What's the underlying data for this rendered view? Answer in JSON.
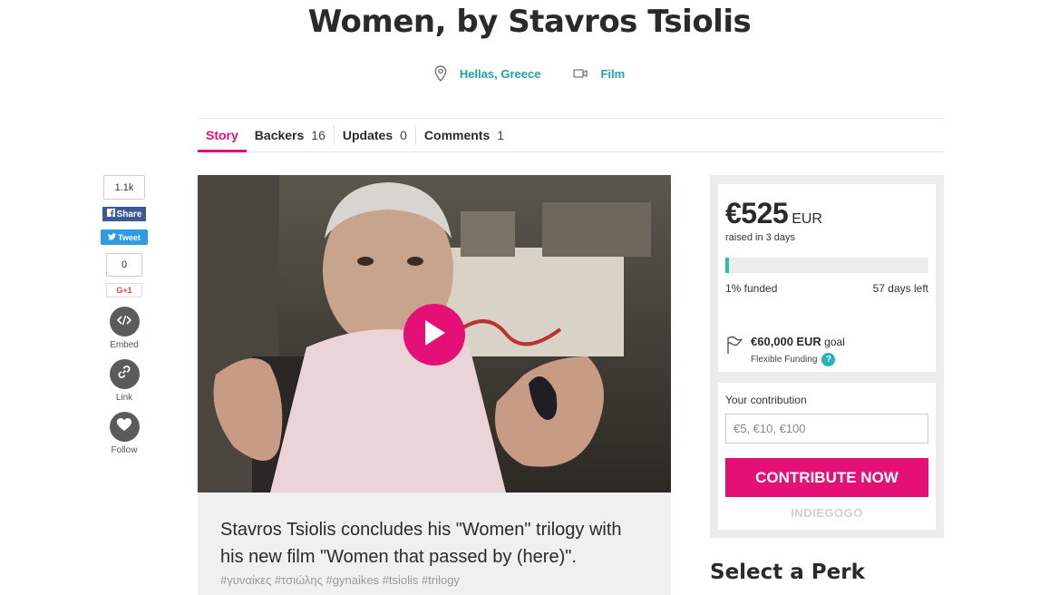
{
  "campaign": {
    "title": "Women, by Stavros Tsiolis",
    "location": "Hellas, Greece",
    "category": "Film"
  },
  "tabs": [
    {
      "label": "Story",
      "count": ""
    },
    {
      "label": "Backers",
      "count": "16"
    },
    {
      "label": "Updates",
      "count": "0"
    },
    {
      "label": "Comments",
      "count": "1"
    }
  ],
  "social": {
    "fb_count": "1.1k",
    "fb_label": "Share",
    "tweet_label": "Tweet",
    "gplus_count": "0",
    "gplus_label": "G+1",
    "embed_label": "Embed",
    "link_label": "Link",
    "follow_label": "Follow"
  },
  "video": {
    "caption": "Stavros Tsiolis concludes his \"Women\" trilogy with his new film \"Women that passed by (here)\".",
    "tags": "#γυναίκες  #τσιώλης  #gynaikes  #tsiolis  #trilogy"
  },
  "funding": {
    "amount": "€525",
    "currency": "EUR",
    "raised_text": "raised in 3 days",
    "percent_funded": 1,
    "funded_label": "1% funded",
    "days_left": "57 days left",
    "goal_amount": "€60,000",
    "goal_currency": "EUR",
    "goal_word": "goal",
    "funding_type": "Flexible Funding"
  },
  "contribute": {
    "label": "Your contribution",
    "placeholder": "€5, €10, €100",
    "button": "CONTRIBUTE NOW",
    "brand": "INDIEGOGO"
  },
  "perks": {
    "heading": "Select a Perk"
  },
  "colors": {
    "accent": "#e51075",
    "teal": "#1fa3a7",
    "progress": "#26c2a0"
  }
}
